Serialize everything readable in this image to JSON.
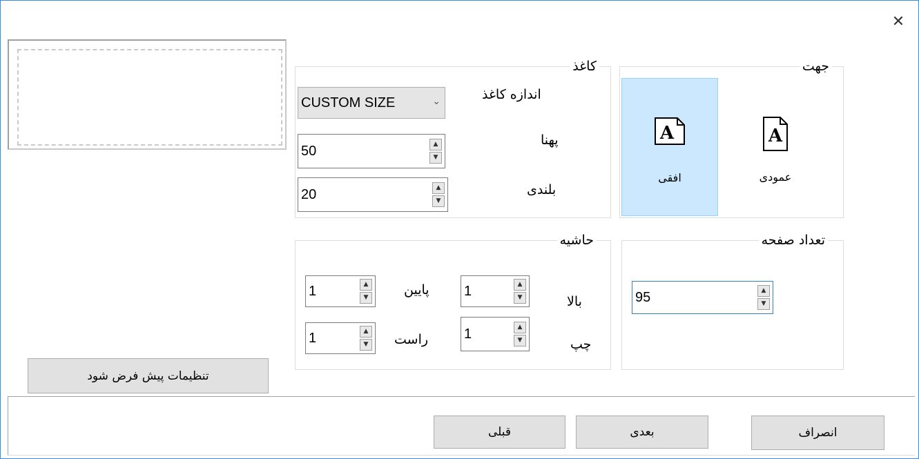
{
  "window": {
    "close_glyph": "✕"
  },
  "orientation": {
    "title": "جهت",
    "portrait_label": "عمودی",
    "landscape_label": "افقی",
    "selected": "landscape",
    "portrait_icon": "portrait-page-icon",
    "landscape_icon": "landscape-page-icon",
    "icon_letter": "A"
  },
  "paper": {
    "title": "کاغذ",
    "size_label": "اندازه کاغذ",
    "size_value": "CUSTOM SIZE",
    "width_label": "پهنا",
    "width_value": "50",
    "height_label": "بلندی",
    "height_value": "20"
  },
  "page_count": {
    "title": "تعداد صفحه",
    "value": "95"
  },
  "margins": {
    "title": "حاشیه",
    "top_label": "بالا",
    "top_value": "1",
    "left_label": "چپ",
    "left_value": "1",
    "bottom_label": "پایین",
    "bottom_value": "1",
    "right_label": "راست",
    "right_value": "1"
  },
  "buttons": {
    "set_default": "تنظیمات پیش فرض شود",
    "cancel": "انصراف",
    "next": "بعدی",
    "previous": "قبلی"
  },
  "colors": {
    "selected_bg": "#cce8ff",
    "window_border": "#3c8ad8",
    "button_bg": "#e1e1e1"
  }
}
